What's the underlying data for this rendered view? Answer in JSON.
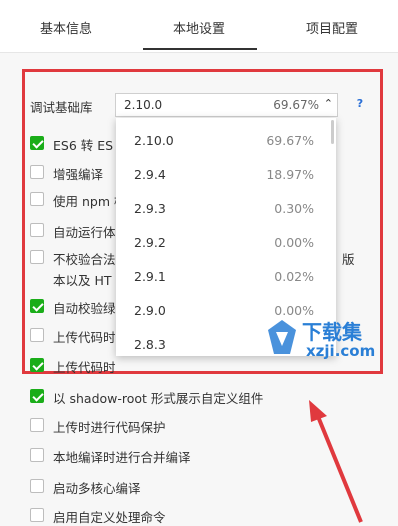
{
  "tabs": [
    {
      "label": "基本信息"
    },
    {
      "label": "本地设置"
    },
    {
      "label": "项目配置"
    }
  ],
  "debug_lib": {
    "label": "调试基础库",
    "selected_version": "2.10.0",
    "selected_pct": "69.67%",
    "help": "?"
  },
  "options": [
    {
      "version": "2.10.0",
      "pct": "69.67%"
    },
    {
      "version": "2.9.4",
      "pct": "18.97%"
    },
    {
      "version": "2.9.3",
      "pct": "0.30%"
    },
    {
      "version": "2.9.2",
      "pct": "0.00%"
    },
    {
      "version": "2.9.1",
      "pct": "0.02%"
    },
    {
      "version": "2.9.0",
      "pct": "0.00%"
    },
    {
      "version": "2.8.3",
      "pct": ""
    }
  ],
  "settings": [
    {
      "label": "ES6 转 ES",
      "checked": true
    },
    {
      "label": "增强编译",
      "checked": false
    },
    {
      "label": "使用 npm 模",
      "checked": false
    },
    {
      "label": "自动运行体",
      "checked": false
    },
    {
      "label": "不校验合法",
      "line2": "本以及 HT",
      "suffix": "版",
      "checked": false
    },
    {
      "label": "自动校验绿",
      "checked": true
    },
    {
      "label": "上传代码时",
      "checked": false
    },
    {
      "label": "上传代码时",
      "checked": true
    },
    {
      "label": "以 shadow-root 形式展示自定义组件",
      "checked": true
    },
    {
      "label": "上传时进行代码保护",
      "checked": false
    },
    {
      "label": "本地编译时进行合并编译",
      "checked": false
    },
    {
      "label": "启动多核心编译",
      "checked": false
    },
    {
      "label": "启用自定义处理命令",
      "checked": false
    }
  ],
  "watermark": {
    "title": "下载集",
    "url": "xzji.com"
  },
  "colors": {
    "accent": "#1aad19",
    "highlight": "#e0393e",
    "link": "#2a6fd6"
  }
}
